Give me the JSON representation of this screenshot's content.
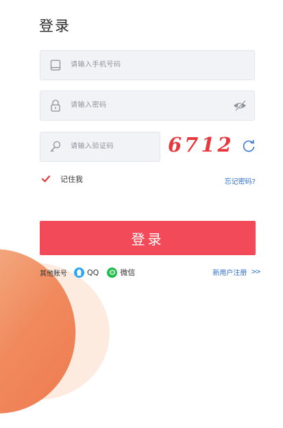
{
  "header": {
    "title": "登录"
  },
  "form": {
    "phone": {
      "placeholder": "请输入手机号码",
      "icon": "phone-icon"
    },
    "password": {
      "placeholder": "请输入密码",
      "icon": "lock-icon",
      "toggle_icon": "eye-hidden-icon"
    },
    "code": {
      "placeholder": "请输入验证码",
      "icon": "key-icon"
    },
    "captcha": {
      "value": "6712",
      "color": "#e8383d",
      "refresh_icon": "refresh-icon"
    },
    "remember": {
      "label": "记住我",
      "checked": true
    },
    "forgot_label": "忘记密码?",
    "submit_label": "登录"
  },
  "footer": {
    "other_label": "其他账号",
    "oauth": [
      {
        "label": "QQ",
        "icon": "qq-icon",
        "color": "#2aa5f3"
      },
      {
        "label": "微信",
        "icon": "wechat-icon",
        "color": "#1fbd4b"
      }
    ],
    "register_label": "新用户注册",
    "register_icon": "double-chevron-right-icon"
  },
  "colors": {
    "accent": "#f24a58",
    "link": "#2f6fd1"
  }
}
